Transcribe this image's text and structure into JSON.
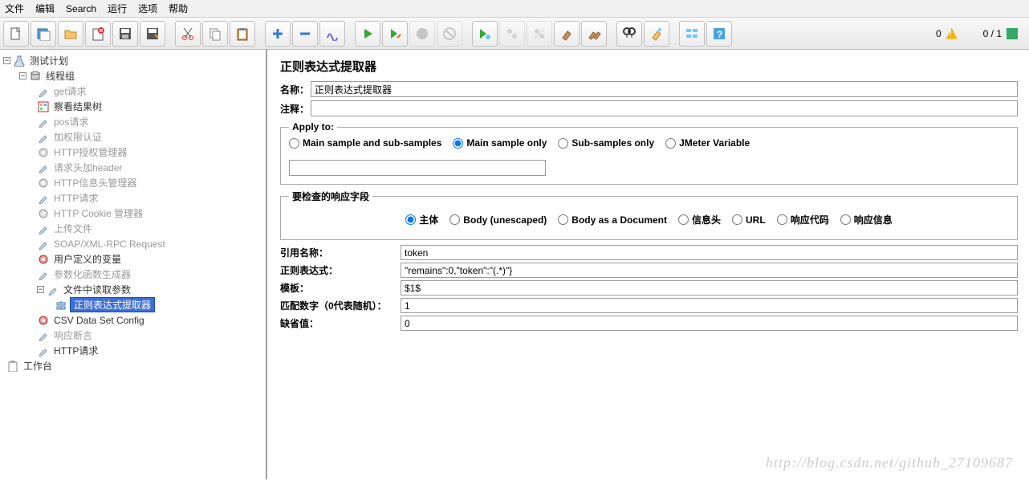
{
  "menu": {
    "file": "文件",
    "edit": "编辑",
    "search": "Search",
    "run": "运行",
    "options": "选项",
    "help": "帮助"
  },
  "status": {
    "errors": "0",
    "threads": "0 / 1"
  },
  "tree": {
    "plan": "测试计划",
    "threadGroup": "线程组",
    "items": [
      {
        "label": "get请求",
        "dim": true,
        "icon": "dropper"
      },
      {
        "label": "察看结果树",
        "dim": false,
        "icon": "tree"
      },
      {
        "label": "pos请求",
        "dim": true,
        "icon": "dropper"
      },
      {
        "label": "加权限认证",
        "dim": true,
        "icon": "dropper"
      },
      {
        "label": "HTTP授权管理器",
        "dim": true,
        "icon": "gear"
      },
      {
        "label": "请求头加header",
        "dim": true,
        "icon": "dropper"
      },
      {
        "label": "HTTP信息头管理器",
        "dim": true,
        "icon": "gear"
      },
      {
        "label": "HTTP请求",
        "dim": true,
        "icon": "dropper"
      },
      {
        "label": "HTTP Cookie 管理器",
        "dim": true,
        "icon": "gear"
      },
      {
        "label": "上传文件",
        "dim": true,
        "icon": "dropper"
      },
      {
        "label": "SOAP/XML-RPC Request",
        "dim": true,
        "icon": "dropper"
      },
      {
        "label": "用户定义的变量",
        "dim": false,
        "icon": "gear-red"
      },
      {
        "label": "参数化函数生成器",
        "dim": true,
        "icon": "dropper"
      },
      {
        "label": "文件中读取参数",
        "dim": false,
        "icon": "dropper",
        "expand": true
      },
      {
        "label": "正则表达式提取器",
        "dim": false,
        "icon": "proc",
        "sel": true,
        "indent": 1
      },
      {
        "label": "CSV Data Set Config",
        "dim": false,
        "icon": "gear-red"
      },
      {
        "label": "响应断言",
        "dim": true,
        "icon": "dropper"
      },
      {
        "label": "HTTP请求",
        "dim": false,
        "icon": "dropper"
      }
    ],
    "workbench": "工作台"
  },
  "panel": {
    "title": "正则表达式提取器",
    "nameLabel": "名称：",
    "nameValue": "正则表达式提取器",
    "commentLabel": "注释：",
    "commentValue": "",
    "applyLegend": "Apply to:",
    "applyOpts": [
      "Main sample and sub-samples",
      "Main sample only",
      "Sub-samples only",
      "JMeter Variable"
    ],
    "applySel": 1,
    "fieldLegend": "要检查的响应字段",
    "fieldOpts": [
      "主体",
      "Body (unescaped)",
      "Body as a Document",
      "信息头",
      "URL",
      "响应代码",
      "响应信息"
    ],
    "fieldSel": 0,
    "refNameLabel": "引用名称：",
    "refName": "token",
    "regexLabel": "正则表达式：",
    "regex": "\"remains\":0,\"token\":\"(.*)\"}",
    "templateLabel": "模板：",
    "template": "$1$",
    "matchLabel": "匹配数字（0代表随机）：",
    "match": "1",
    "defaultLabel": "缺省值：",
    "default": "0"
  },
  "watermark": "http://blog.csdn.net/github_27109687"
}
